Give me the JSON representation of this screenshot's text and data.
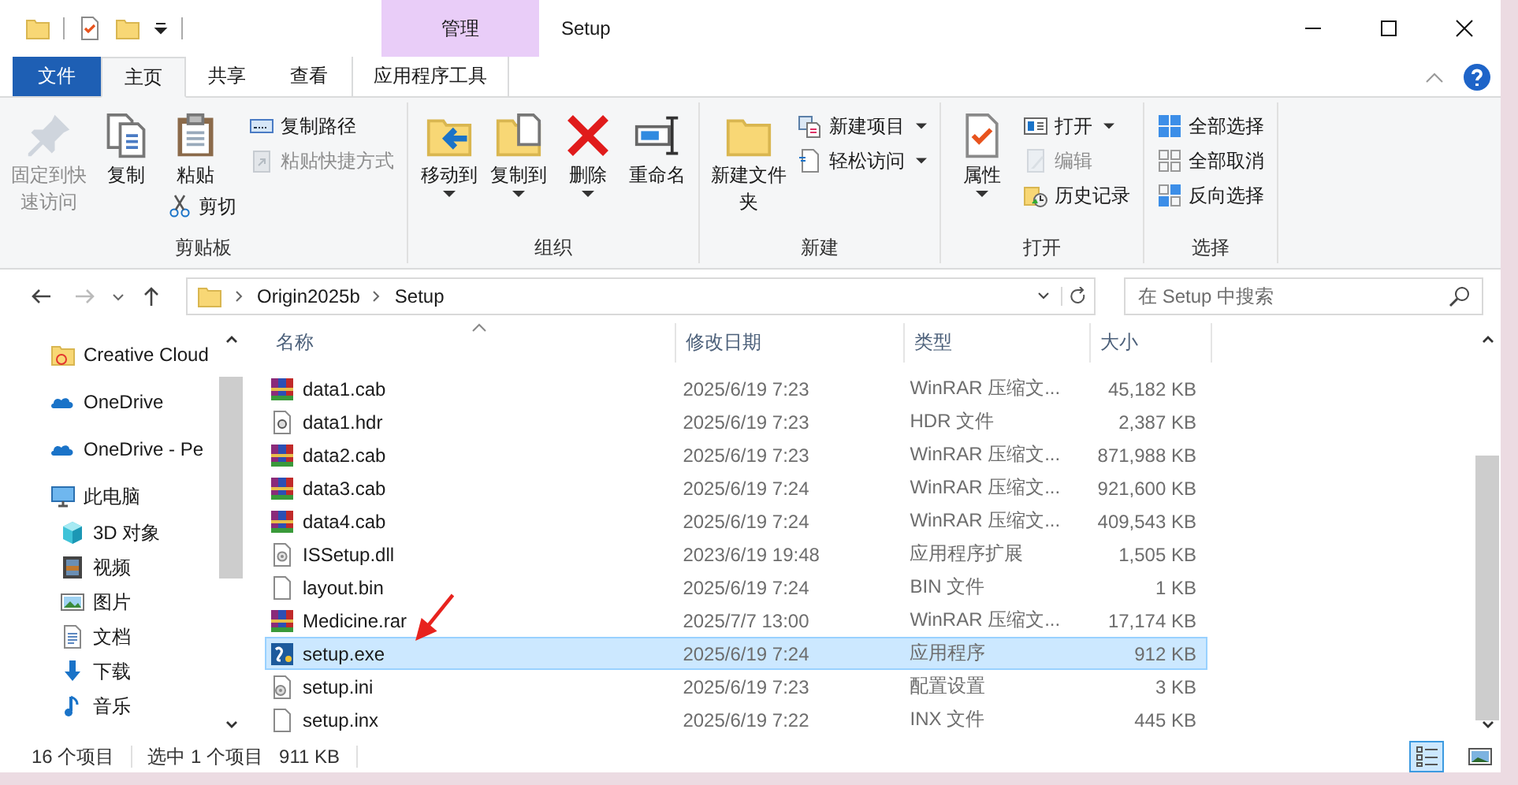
{
  "title_bar": {
    "context_tab": "管理",
    "title": "Setup"
  },
  "ribbon_tabs": [
    {
      "label": "文件",
      "kind": "file",
      "selected": false
    },
    {
      "label": "主页",
      "kind": "normal",
      "selected": true
    },
    {
      "label": "共享",
      "kind": "normal",
      "selected": false
    },
    {
      "label": "查看",
      "kind": "normal",
      "selected": false
    },
    {
      "label": "应用程序工具",
      "kind": "context",
      "selected": false
    }
  ],
  "ribbon_groups": [
    {
      "label": "剪贴板",
      "columns": [
        {
          "kind": "large",
          "items": [
            {
              "label": "固定到快速访问",
              "kind": "pin",
              "disabled": true,
              "dropdown": false
            }
          ]
        },
        {
          "kind": "large",
          "items": [
            {
              "label": "复制",
              "kind": "copy",
              "disabled": false,
              "dropdown": false
            }
          ]
        },
        {
          "kind": "large",
          "items": [
            {
              "label": "粘贴",
              "kind": "paste",
              "disabled": false,
              "dropdown": false
            },
            {
              "label": "剪切",
              "kind": "cut",
              "disabled": false,
              "dropdown": false
            }
          ]
        },
        {
          "kind": "stack",
          "items": [
            {
              "label": "复制路径",
              "kind": "copypath",
              "disabled": false,
              "dropdown": false
            },
            {
              "label": "粘贴快捷方式",
              "kind": "pasteshortcut",
              "disabled": true,
              "dropdown": false
            }
          ]
        }
      ]
    },
    {
      "label": "组织",
      "columns": [
        {
          "kind": "large",
          "items": [
            {
              "label": "移动到",
              "kind": "moveto",
              "disabled": false,
              "dropdown": true
            }
          ]
        },
        {
          "kind": "large",
          "items": [
            {
              "label": "复制到",
              "kind": "copyto",
              "disabled": false,
              "dropdown": true
            }
          ]
        },
        {
          "kind": "large",
          "items": [
            {
              "label": "删除",
              "kind": "delete",
              "disabled": false,
              "dropdown": true
            }
          ]
        },
        {
          "kind": "large",
          "items": [
            {
              "label": "重命名",
              "kind": "rename",
              "disabled": false,
              "dropdown": false
            }
          ]
        }
      ]
    },
    {
      "label": "新建",
      "columns": [
        {
          "kind": "large",
          "items": [
            {
              "label": "新建文件夹",
              "kind": "newfolder",
              "disabled": false,
              "dropdown": false
            }
          ]
        },
        {
          "kind": "stack",
          "items": [
            {
              "label": "新建项目",
              "kind": "newitem",
              "disabled": false,
              "dropdown": true
            },
            {
              "label": "轻松访问",
              "kind": "easyaccess",
              "disabled": false,
              "dropdown": true
            }
          ]
        }
      ]
    },
    {
      "label": "打开",
      "columns": [
        {
          "kind": "large",
          "items": [
            {
              "label": "属性",
              "kind": "properties",
              "disabled": false,
              "dropdown": true
            }
          ]
        },
        {
          "kind": "stack",
          "items": [
            {
              "label": "打开",
              "kind": "open",
              "disabled": false,
              "dropdown": true
            },
            {
              "label": "编辑",
              "kind": "edit",
              "disabled": true,
              "dropdown": false
            },
            {
              "label": "历史记录",
              "kind": "history",
              "disabled": false,
              "dropdown": false
            }
          ]
        }
      ]
    },
    {
      "label": "选择",
      "columns": [
        {
          "kind": "stack",
          "items": [
            {
              "label": "全部选择",
              "kind": "selectall",
              "disabled": false,
              "dropdown": false
            },
            {
              "label": "全部取消",
              "kind": "selectnone",
              "disabled": false,
              "dropdown": false
            },
            {
              "label": "反向选择",
              "kind": "invert",
              "disabled": false,
              "dropdown": false
            }
          ]
        }
      ]
    }
  ],
  "address": {
    "breadcrumbs": [
      "Origin2025b",
      "Setup"
    ]
  },
  "search": {
    "placeholder": "在 Setup 中搜索"
  },
  "nav": [
    {
      "label": "Creative Cloud",
      "kind": "cc"
    },
    {
      "label": "OneDrive",
      "kind": "onedrive"
    },
    {
      "label": "OneDrive - Pe",
      "kind": "onedrive"
    },
    {
      "label": "此电脑",
      "kind": "pc",
      "children": [
        {
          "label": "3D 对象",
          "kind": "cube"
        },
        {
          "label": "视频",
          "kind": "video"
        },
        {
          "label": "图片",
          "kind": "pictures"
        },
        {
          "label": "文档",
          "kind": "docs"
        },
        {
          "label": "下载",
          "kind": "downloads"
        },
        {
          "label": "音乐",
          "kind": "music"
        }
      ]
    }
  ],
  "table": {
    "columns": [
      {
        "label": "名称",
        "sorted": true
      },
      {
        "label": "修改日期",
        "sorted": false
      },
      {
        "label": "类型",
        "sorted": false
      },
      {
        "label": "大小",
        "sorted": false
      }
    ],
    "rows": [
      {
        "name": "data1.cab",
        "date": "2025/6/19 7:23",
        "type": "WinRAR 压缩文...",
        "size": "45,182 KB",
        "kind": "rar",
        "selected": false
      },
      {
        "name": "data1.hdr",
        "date": "2025/6/19 7:23",
        "type": "HDR 文件",
        "size": "2,387 KB",
        "kind": "hdr",
        "selected": false
      },
      {
        "name": "data2.cab",
        "date": "2025/6/19 7:23",
        "type": "WinRAR 压缩文...",
        "size": "871,988 KB",
        "kind": "rar",
        "selected": false
      },
      {
        "name": "data3.cab",
        "date": "2025/6/19 7:24",
        "type": "WinRAR 压缩文...",
        "size": "921,600 KB",
        "kind": "rar",
        "selected": false
      },
      {
        "name": "data4.cab",
        "date": "2025/6/19 7:24",
        "type": "WinRAR 压缩文...",
        "size": "409,543 KB",
        "kind": "rar",
        "selected": false
      },
      {
        "name": "ISSetup.dll",
        "date": "2023/6/19 19:48",
        "type": "应用程序扩展",
        "size": "1,505 KB",
        "kind": "dll",
        "selected": false
      },
      {
        "name": "layout.bin",
        "date": "2025/6/19 7:24",
        "type": "BIN 文件",
        "size": "1 KB",
        "kind": "blank",
        "selected": false
      },
      {
        "name": "Medicine.rar",
        "date": "2025/7/7 13:00",
        "type": "WinRAR 压缩文...",
        "size": "17,174 KB",
        "kind": "rar",
        "selected": false
      },
      {
        "name": "setup.exe",
        "date": "2025/6/19 7:24",
        "type": "应用程序",
        "size": "912 KB",
        "kind": "exe",
        "selected": true
      },
      {
        "name": "setup.ini",
        "date": "2025/6/19 7:23",
        "type": "配置设置",
        "size": "3 KB",
        "kind": "ini",
        "selected": false
      },
      {
        "name": "setup.inx",
        "date": "2025/6/19 7:22",
        "type": "INX 文件",
        "size": "445 KB",
        "kind": "blank",
        "selected": false
      }
    ]
  },
  "status_bar": {
    "count": "16 个项目",
    "selection": "选中 1 个项目",
    "size": "911 KB"
  },
  "view_buttons": [
    {
      "kind": "details",
      "selected": true
    },
    {
      "kind": "large",
      "selected": false
    }
  ]
}
